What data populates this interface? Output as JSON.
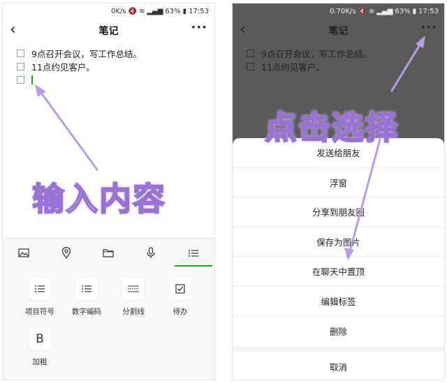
{
  "left": {
    "status": {
      "speed": "0K/s",
      "battery": "63%",
      "time": "17:53"
    },
    "header": {
      "back_icon": "‹",
      "title": "笔记",
      "more_icon": "···"
    },
    "todos": [
      {
        "text": "9点召开会议，写工作总结。"
      },
      {
        "text": "11点约见客户。"
      },
      {
        "text": ""
      }
    ],
    "annotation": "输入内容",
    "toolbar": [
      "image-icon",
      "location-icon",
      "folder-icon",
      "mic-icon",
      "list-icon"
    ],
    "format_buttons": [
      {
        "label": "项目符号",
        "icon": "bullet-list-icon"
      },
      {
        "label": "数字编码",
        "icon": "numbered-list-icon"
      },
      {
        "label": "分割线",
        "icon": "divider-icon"
      },
      {
        "label": "待办",
        "icon": "checkbox-icon"
      },
      {
        "label": "加粗",
        "glyph": "B",
        "icon": "bold-icon"
      }
    ],
    "accent": "#1aad19"
  },
  "right": {
    "status": {
      "speed": "0.70K/s",
      "battery": "63%",
      "time": "17:53"
    },
    "header": {
      "back_icon": "‹",
      "title": "笔记",
      "more_icon": "···"
    },
    "todos": [
      {
        "text": "9点召开会议，写工作总结。"
      },
      {
        "text": "11点约见客户。"
      }
    ],
    "annotation": "点击选择",
    "menu": [
      "发送给朋友",
      "浮窗",
      "分享到朋友圈",
      "保存为图片",
      "在聊天中置顶",
      "编辑标签",
      "删除"
    ],
    "cancel": "取消"
  }
}
